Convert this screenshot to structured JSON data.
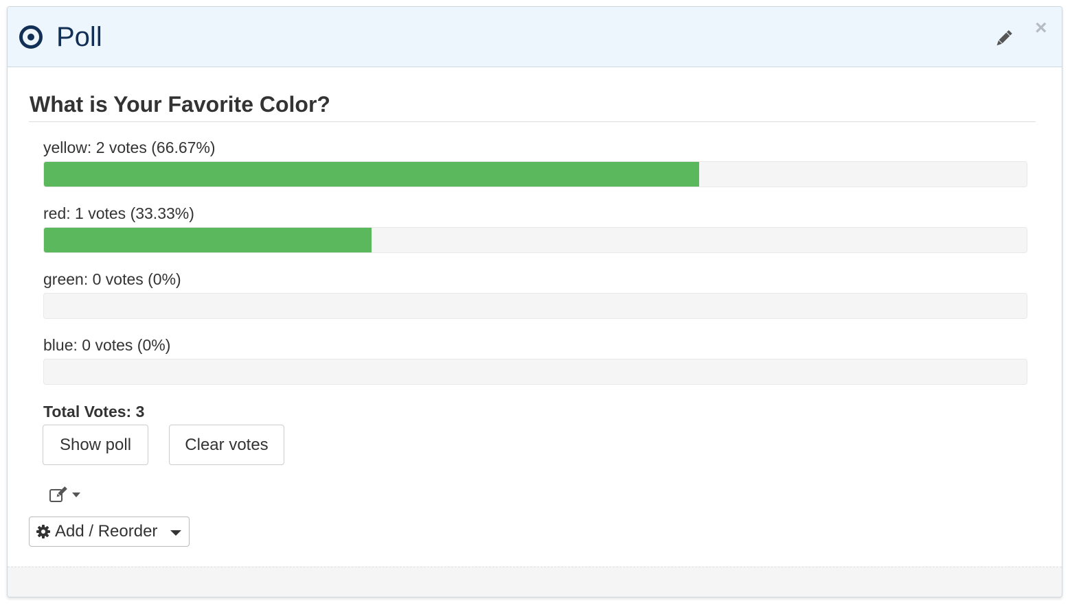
{
  "header": {
    "title": "Poll",
    "icon": "poll-radio-icon",
    "edit_icon": "pencil-icon",
    "close_icon": "close-icon",
    "background_color": "#eef6fd",
    "title_color": "#123055"
  },
  "poll": {
    "question": "What is Your Favorite Color?",
    "bar_color": "#5cb85c",
    "options": [
      {
        "label": "yellow: 2 votes (66.67%)",
        "name": "yellow",
        "votes": 2,
        "percent": 66.67
      },
      {
        "label": "red: 1 votes (33.33%)",
        "name": "red",
        "votes": 1,
        "percent": 33.33
      },
      {
        "label": "green: 0 votes (0%)",
        "name": "green",
        "votes": 0,
        "percent": 0
      },
      {
        "label": "blue: 0 votes (0%)",
        "name": "blue",
        "votes": 0,
        "percent": 0
      }
    ],
    "total_label": "Total Votes: 3"
  },
  "actions": {
    "show_poll_label": "Show poll",
    "clear_votes_label": "Clear votes",
    "edit_dropdown_icon": "edit-icon",
    "add_reorder_label": "Add / Reorder",
    "add_reorder_icon": "gear-icon"
  }
}
